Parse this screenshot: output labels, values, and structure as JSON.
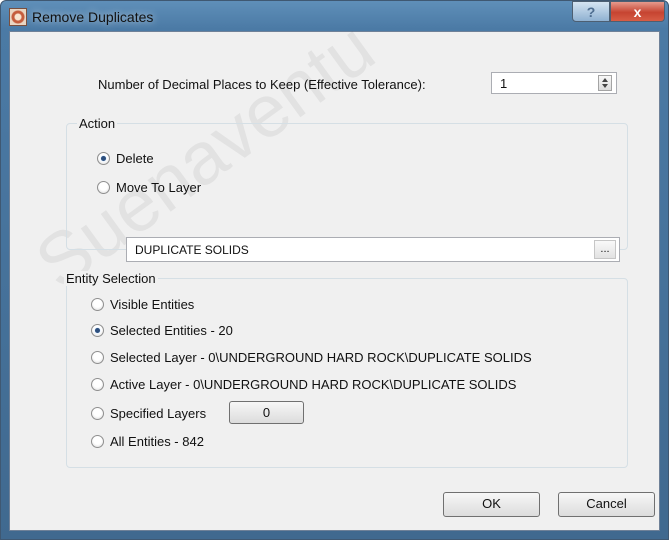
{
  "window": {
    "title": "Remove Duplicates",
    "help_label": "?",
    "close_label": "x"
  },
  "tolerance": {
    "label": "Number of Decimal Places to Keep (Effective Tolerance):",
    "value": "1"
  },
  "action": {
    "title": "Action",
    "delete_label": "Delete",
    "move_label": "Move To Layer",
    "layer_value": "DUPLICATE SOLIDS",
    "browse_label": "..."
  },
  "entity_selection": {
    "title": "Entity Selection",
    "visible_entities": "Visible Entities",
    "selected_entities": "Selected Entities - 20",
    "selected_layer": "Selected Layer - 0\\UNDERGROUND HARD ROCK\\DUPLICATE SOLIDS",
    "active_layer": "Active Layer - 0\\UNDERGROUND HARD ROCK\\DUPLICATE SOLIDS",
    "specified_layers": "Specified Layers",
    "specified_layers_button": "0",
    "all_entities": "All Entities - 842"
  },
  "buttons": {
    "ok": "OK",
    "cancel": "Cancel"
  },
  "colors": {
    "title_bar": "#4b7aa5",
    "dialog_background": "#f0f0f0",
    "close_button": "#c64431"
  }
}
